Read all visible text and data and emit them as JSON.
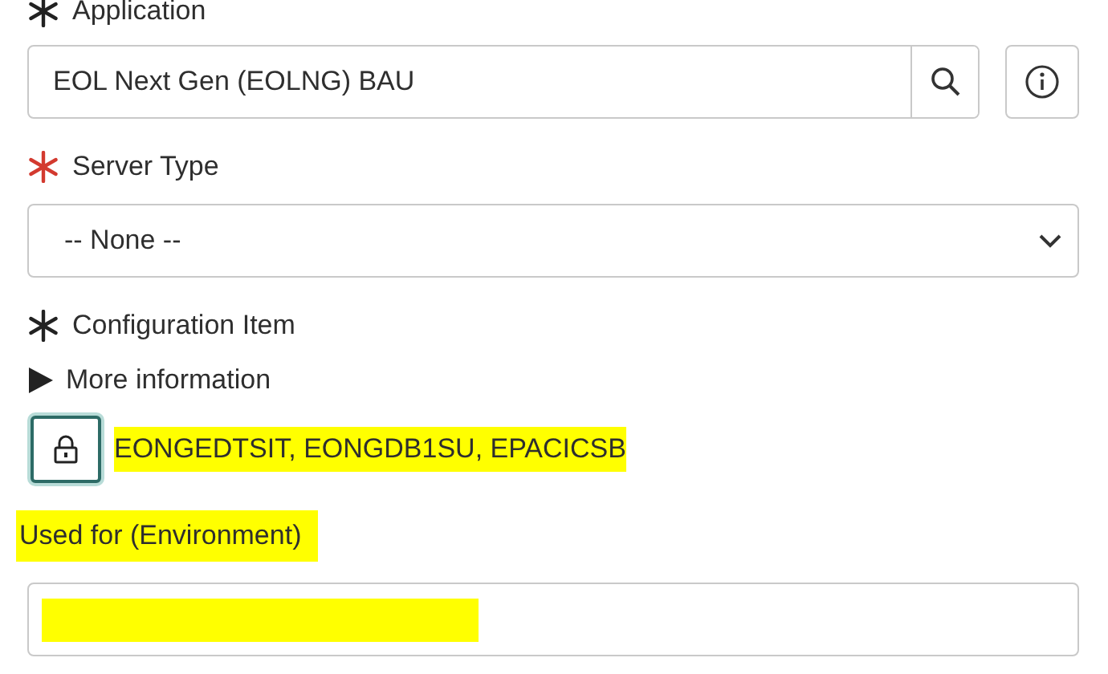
{
  "application": {
    "label": "Application",
    "satisfied": true,
    "value": "EOL Next Gen (EOLNG) BAU"
  },
  "server_type": {
    "label": "Server Type",
    "satisfied": false,
    "value": "-- None --"
  },
  "configuration_item": {
    "label": "Configuration Item",
    "satisfied": true,
    "more_information": {
      "label": "More information",
      "expanded": false
    },
    "locked": true,
    "value": "EONGEDTSIT, EONGDB1SU, EPACICSB",
    "highlighted": true
  },
  "used_for": {
    "label": "Used for (Environment)",
    "highlighted": true,
    "redacted": true
  }
}
